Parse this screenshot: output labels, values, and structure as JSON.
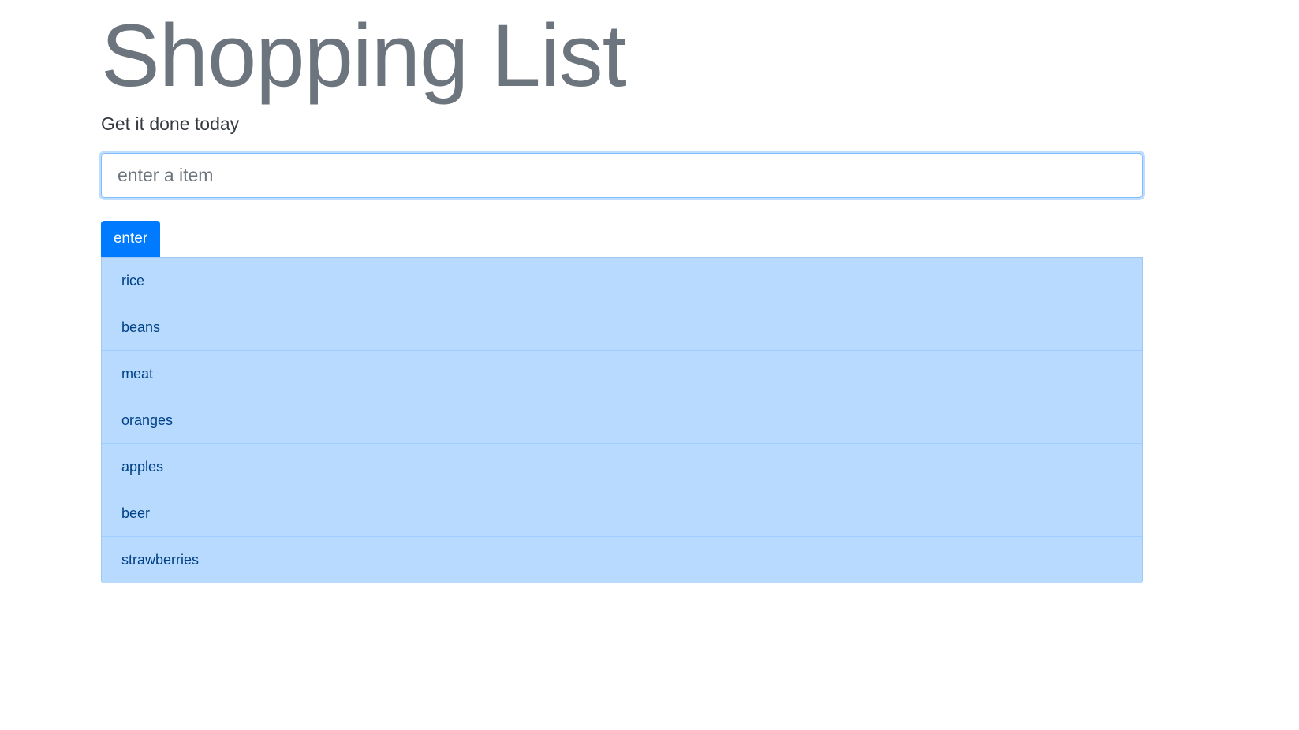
{
  "header": {
    "title": "Shopping List",
    "subtitle": "Get it done today"
  },
  "form": {
    "placeholder": "enter a item",
    "value": "",
    "button_label": "enter"
  },
  "items": [
    "rice",
    "beans",
    "meat",
    "oranges",
    "apples",
    "beer",
    "strawberries"
  ]
}
